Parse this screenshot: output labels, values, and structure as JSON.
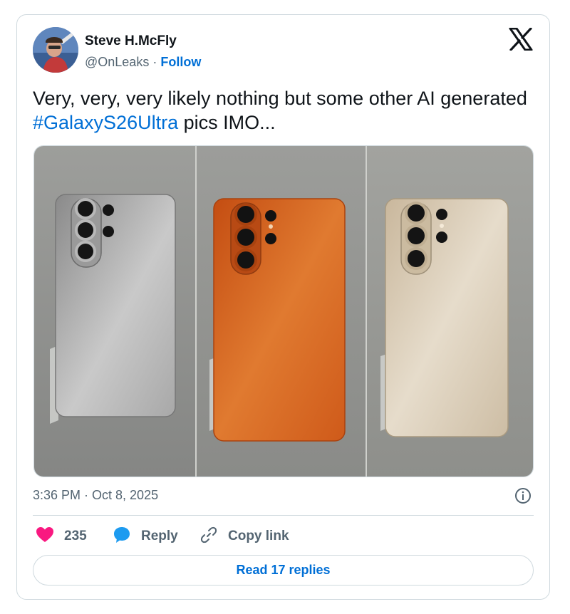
{
  "author": {
    "name": "Steve H.McFly",
    "handle": "@OnLeaks",
    "separator": " · ",
    "follow_label": "Follow"
  },
  "tweet": {
    "text_before": "Very, very, very likely nothing but some other AI generated ",
    "hashtag": "#GalaxyS26Ultra",
    "text_after": " pics IMO..."
  },
  "media": {
    "phones": [
      "silver phone back",
      "orange phone back",
      "gold phone back"
    ],
    "colors": {
      "silver": "#b9b9b9",
      "orange": "#d9621e",
      "gold": "#d8c9b0"
    }
  },
  "meta": {
    "timestamp": "3:36 PM · Oct 8, 2025"
  },
  "actions": {
    "like_count": "235",
    "reply_label": "Reply",
    "copy_label": "Copy link",
    "read_replies_label": "Read 17 replies"
  },
  "icons": [
    "x-logo-icon",
    "info-icon",
    "heart-icon",
    "reply-bubble-icon",
    "link-icon"
  ],
  "theme": {
    "accent": "#006fd6",
    "heart": "#f91880",
    "muted": "#536471",
    "border": "#cfd9de"
  }
}
